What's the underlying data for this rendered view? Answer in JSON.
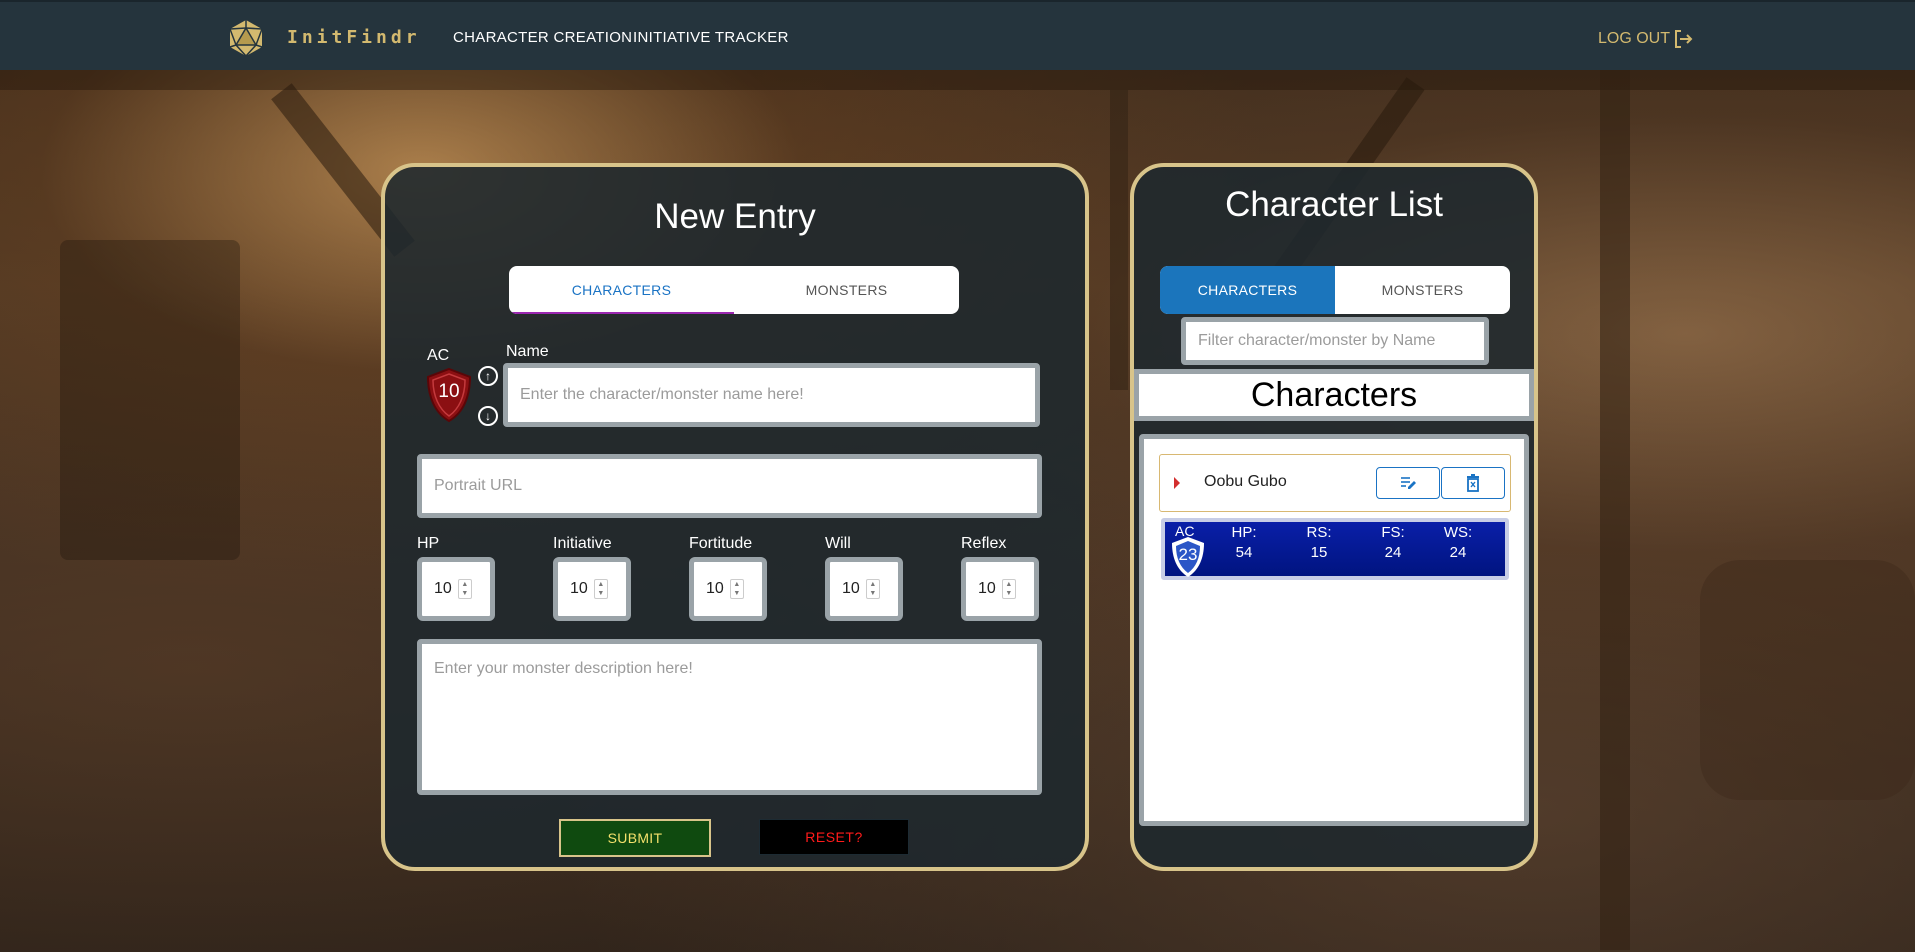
{
  "navbar": {
    "brand": "InitFindr",
    "links": [
      "CHARACTER CREATION",
      "INITIATIVE TRACKER"
    ],
    "logout_label": "LOG OUT"
  },
  "new_entry": {
    "title": "New Entry",
    "tabs": [
      "CHARACTERS",
      "MONSTERS"
    ],
    "active_tab": "CHARACTERS",
    "ac_label": "AC",
    "ac_value": "10",
    "name_label": "Name",
    "name_placeholder": "Enter the character/monster name here!",
    "portrait_placeholder": "Portrait URL",
    "stats": [
      {
        "label": "HP",
        "value": "10"
      },
      {
        "label": "Initiative",
        "value": "10"
      },
      {
        "label": "Fortitude",
        "value": "10"
      },
      {
        "label": "Will",
        "value": "10"
      },
      {
        "label": "Reflex",
        "value": "10"
      }
    ],
    "description_placeholder": "Enter your monster description here!",
    "submit_label": "SUBMIT",
    "reset_label": "RESET?"
  },
  "character_list": {
    "title": "Character List",
    "tabs": [
      "CHARACTERS",
      "MONSTERS"
    ],
    "active_tab": "CHARACTERS",
    "filter_placeholder": "Filter character/monster by Name",
    "section_title": "Characters",
    "entries": [
      {
        "name": "Oobu Gubo",
        "ac_label": "AC",
        "ac": "23",
        "stats": [
          {
            "label": "HP:",
            "value": "54"
          },
          {
            "label": "RS:",
            "value": "15"
          },
          {
            "label": "FS:",
            "value": "24"
          },
          {
            "label": "WS:",
            "value": "24"
          }
        ]
      }
    ]
  },
  "colors": {
    "navbar_bg": "#25343d",
    "gold": "#d3b96f",
    "panel_border": "#d8c48a",
    "accent_blue": "#1b75bc",
    "submit_bg": "#0f4a0f",
    "reset_text": "#ff1a1a",
    "ac_shield": "#8b0f12",
    "stats_card_bg": "#0a1fa8"
  },
  "icons": {
    "logo": "d20-icon",
    "logout": "logout-icon",
    "ac_up": "arrow-up-circle-icon",
    "ac_down": "arrow-down-circle-icon",
    "edit": "edit-icon",
    "delete": "trash-icon",
    "expand": "caret-right-icon"
  }
}
